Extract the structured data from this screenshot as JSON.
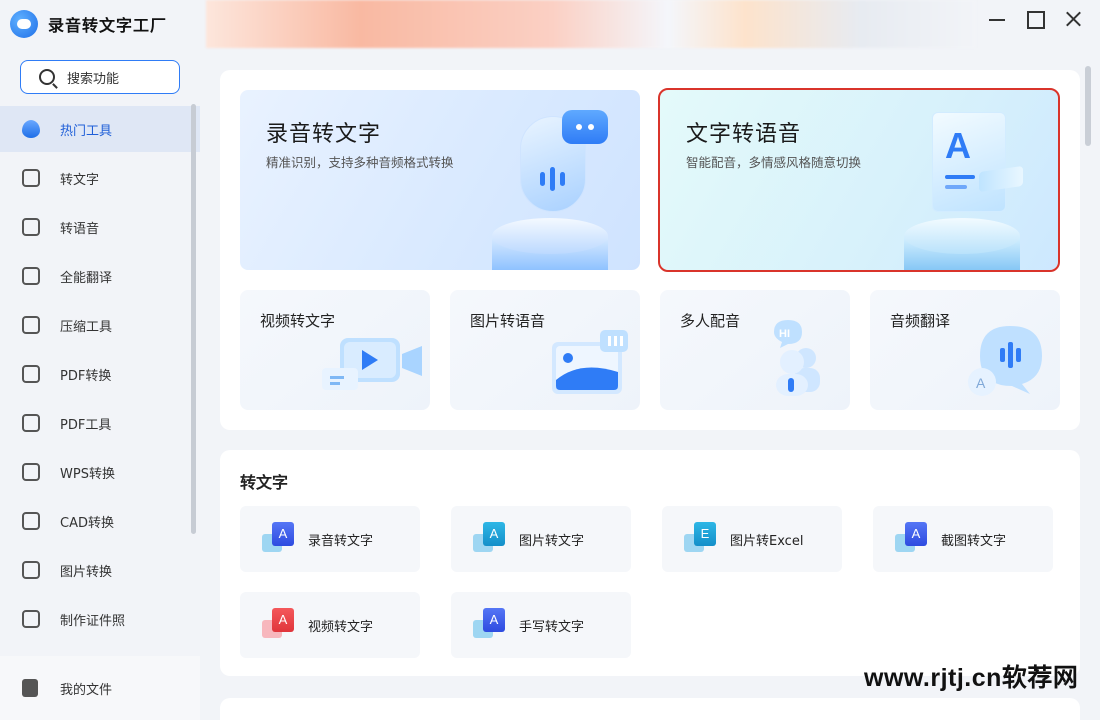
{
  "app": {
    "title": "录音转文字工厂"
  },
  "sidebar": {
    "search_label": "搜索功能",
    "items": [
      {
        "label": "热门工具",
        "icon": "flame-icon",
        "active": true
      },
      {
        "label": "转文字",
        "icon": "text-convert-icon"
      },
      {
        "label": "转语音",
        "icon": "voice-icon"
      },
      {
        "label": "全能翻译",
        "icon": "translate-icon"
      },
      {
        "label": "压缩工具",
        "icon": "compress-icon"
      },
      {
        "label": "PDF转换",
        "icon": "pdf-convert-icon"
      },
      {
        "label": "PDF工具",
        "icon": "toolbox-icon"
      },
      {
        "label": "WPS转换",
        "icon": "wps-icon"
      },
      {
        "label": "CAD转换",
        "icon": "cad-icon"
      },
      {
        "label": "图片转换",
        "icon": "image-icon"
      },
      {
        "label": "制作证件照",
        "icon": "id-photo-icon"
      }
    ],
    "bottom_label": "我的文件"
  },
  "hero": {
    "left": {
      "title": "录音转文字",
      "subtitle": "精准识别，支持多种音频格式转换"
    },
    "right": {
      "title": "文字转语音",
      "subtitle": "智能配音，多情感风格随意切换",
      "highlight_color": "#d9342b"
    }
  },
  "tiles": [
    {
      "label": "视频转文字",
      "icon": "video-play-icon"
    },
    {
      "label": "图片转语音",
      "icon": "image-audio-icon"
    },
    {
      "label": "多人配音",
      "icon": "multi-voice-icon"
    },
    {
      "label": "音频翻译",
      "icon": "audio-translate-icon"
    }
  ],
  "section_to_text": {
    "title": "转文字",
    "cards": [
      {
        "label": "录音转文字",
        "glyph": "A",
        "style": "blue"
      },
      {
        "label": "图片转文字",
        "glyph": "A",
        "style": "cyan"
      },
      {
        "label": "图片转Excel",
        "glyph": "E",
        "style": "cyan"
      },
      {
        "label": "截图转文字",
        "glyph": "A",
        "style": "blue"
      },
      {
        "label": "视频转文字",
        "glyph": "A",
        "style": "red"
      },
      {
        "label": "手写转文字",
        "glyph": "A",
        "style": "blue"
      }
    ]
  },
  "watermark": "www.rjtj.cn软荐网",
  "colors": {
    "accent": "#2f7cf6",
    "sidebar_bg": "#f2f4f8",
    "active_bg": "#dfe7f5"
  }
}
